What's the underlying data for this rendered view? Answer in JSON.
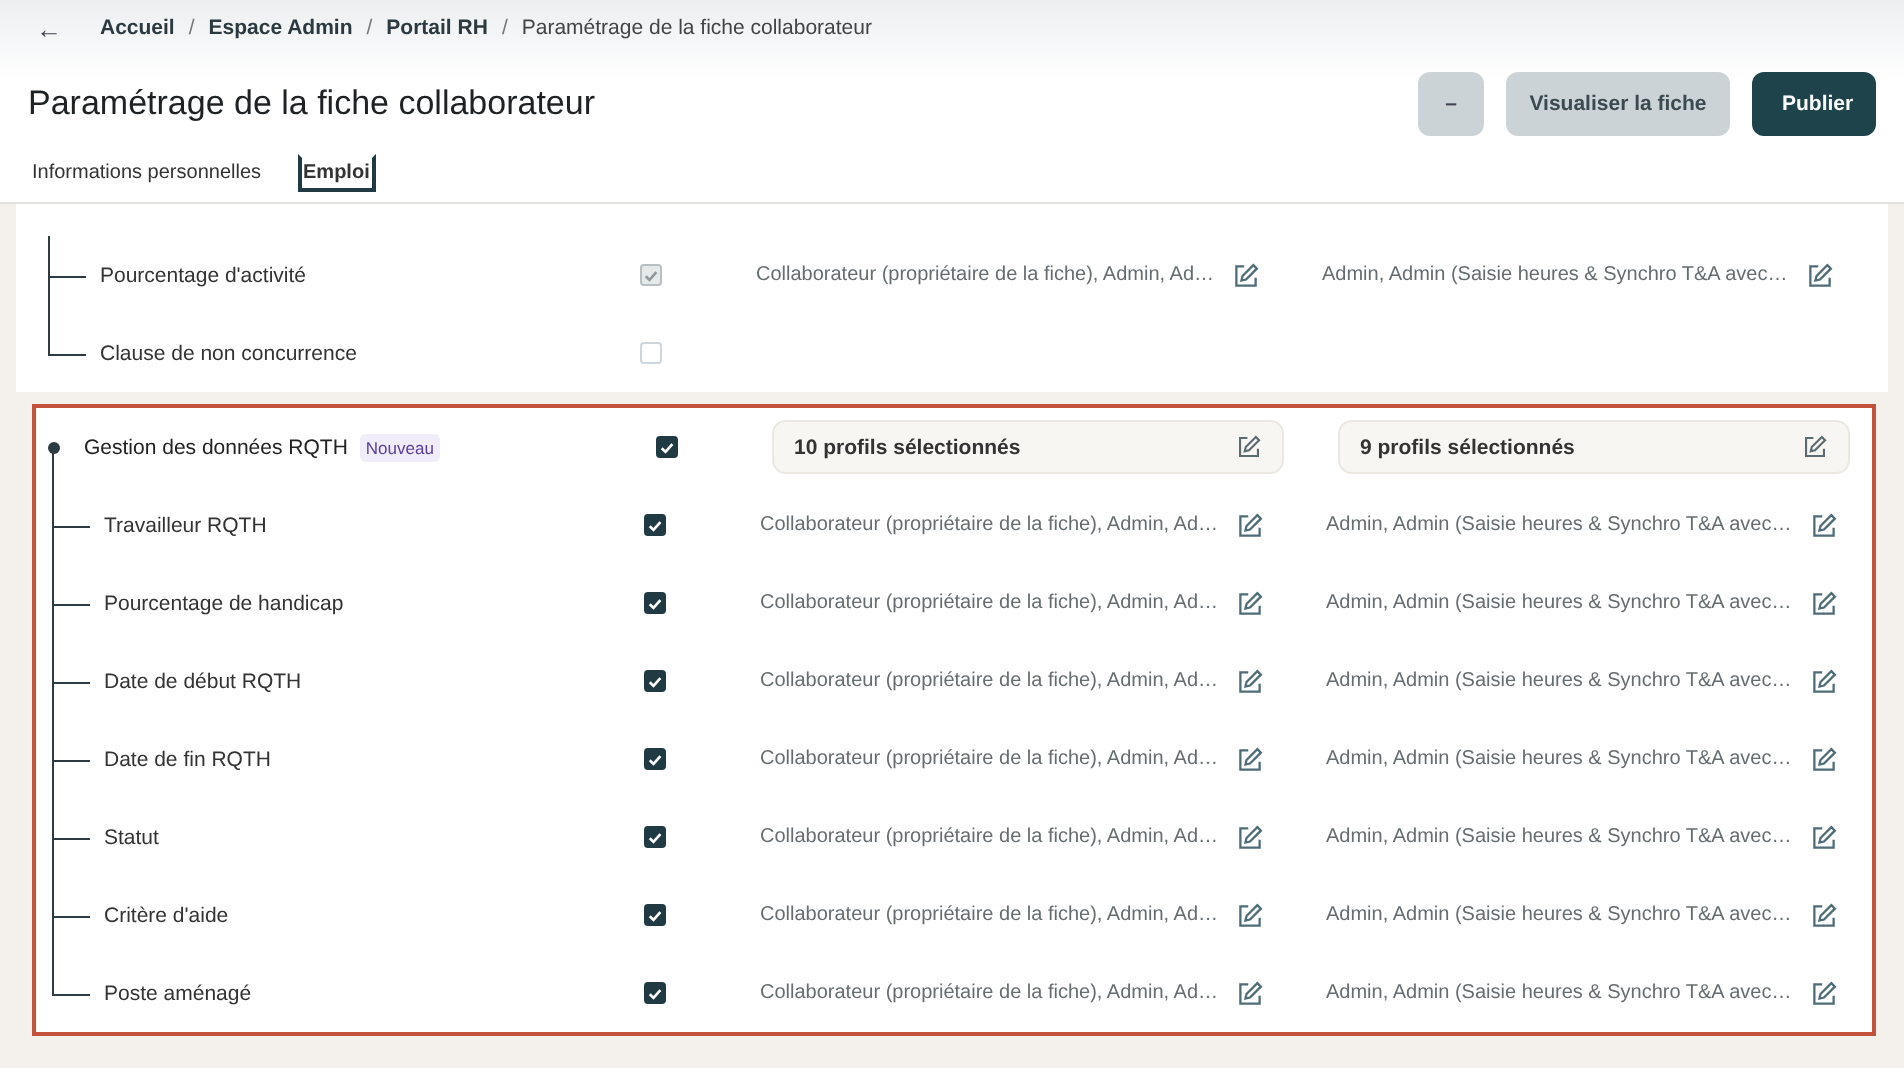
{
  "breadcrumb": {
    "back": "←",
    "separator": "/",
    "items": [
      "Accueil",
      "Espace Admin",
      "Portail RH",
      "Paramétrage de la fiche collaborateur"
    ]
  },
  "title": "Paramétrage de la fiche collaborateur",
  "actions": [
    {
      "label": "–",
      "kind": "more"
    },
    {
      "label": "Visualiser la fiche",
      "kind": "secondary"
    },
    {
      "label": "Publier",
      "kind": "primary"
    }
  ],
  "tabs": [
    {
      "label": "Informations personnelles",
      "selected": false
    },
    {
      "label": "Emploi",
      "selected": true
    }
  ],
  "sections": [
    {
      "highlighted": false,
      "rows": [
        {
          "kind": "child",
          "label": "Pourcentage d'activité",
          "checked": true,
          "disabled": true,
          "read": "Collaborateur (propriétaire de la fiche), Admin, Ad…",
          "write": "Admin, Admin (Saisie heures & Synchro T&A avec…"
        },
        {
          "kind": "child",
          "label": "Clause de non concurrence",
          "checked": false,
          "disabled": false
        }
      ]
    },
    {
      "highlighted": true,
      "rows": [
        {
          "kind": "group",
          "label": "Gestion des données RQTH",
          "badge": "Nouveau",
          "checked": true,
          "disabled": false,
          "read": "10 profils sélectionnés",
          "write": "9 profils sélectionnés"
        },
        {
          "kind": "child",
          "label": "Travailleur RQTH",
          "checked": true,
          "disabled": false,
          "read": "Collaborateur (propriétaire de la fiche), Admin, Ad…",
          "write": "Admin, Admin (Saisie heures & Synchro T&A avec…"
        },
        {
          "kind": "child",
          "label": "Pourcentage de handicap",
          "checked": true,
          "disabled": false,
          "read": "Collaborateur (propriétaire de la fiche), Admin, Ad…",
          "write": "Admin, Admin (Saisie heures & Synchro T&A avec…"
        },
        {
          "kind": "child",
          "label": "Date de début RQTH",
          "checked": true,
          "disabled": false,
          "read": "Collaborateur (propriétaire de la fiche), Admin, Ad…",
          "write": "Admin, Admin (Saisie heures & Synchro T&A avec…"
        },
        {
          "kind": "child",
          "label": "Date de fin RQTH",
          "checked": true,
          "disabled": false,
          "read": "Collaborateur (propriétaire de la fiche), Admin, Ad…",
          "write": "Admin, Admin (Saisie heures & Synchro T&A avec…"
        },
        {
          "kind": "child",
          "label": "Statut",
          "checked": true,
          "disabled": false,
          "read": "Collaborateur (propriétaire de la fiche), Admin, Ad…",
          "write": "Admin, Admin (Saisie heures & Synchro T&A avec…"
        },
        {
          "kind": "child",
          "label": "Critère d'aide",
          "checked": true,
          "disabled": false,
          "read": "Collaborateur (propriétaire de la fiche), Admin, Ad…",
          "write": "Admin, Admin (Saisie heures & Synchro T&A avec…"
        },
        {
          "kind": "child",
          "label": "Poste aménagé",
          "checked": true,
          "disabled": false,
          "read": "Collaborateur (propriétaire de la fiche), Admin, Ad…",
          "write": "Admin, Admin (Saisie heures & Synchro T&A avec…"
        }
      ]
    }
  ]
}
